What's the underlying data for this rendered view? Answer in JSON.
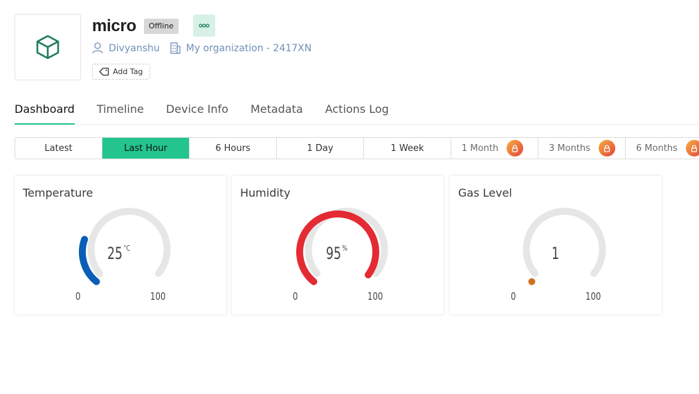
{
  "header": {
    "device_name": "micro",
    "status": "Offline",
    "owner": "Divyanshu",
    "organization": "My organization - 2417XN",
    "add_tag_label": "Add Tag"
  },
  "tabs": [
    {
      "label": "Dashboard",
      "active": true
    },
    {
      "label": "Timeline"
    },
    {
      "label": "Device Info"
    },
    {
      "label": "Metadata"
    },
    {
      "label": "Actions Log"
    }
  ],
  "time_ranges": [
    {
      "label": "Latest"
    },
    {
      "label": "Last Hour",
      "active": true
    },
    {
      "label": "6 Hours"
    },
    {
      "label": "1 Day"
    },
    {
      "label": "1 Week"
    },
    {
      "label": "1 Month",
      "locked": true
    },
    {
      "label": "3 Months",
      "locked": true
    },
    {
      "label": "6 Months",
      "locked": true
    }
  ],
  "widgets": [
    {
      "title": "Temperature",
      "value": "25",
      "unit": "°C",
      "min": "0",
      "max": "100",
      "fraction": 0.25,
      "color": "#0a5eb8"
    },
    {
      "title": "Humidity",
      "value": "95",
      "unit": "%",
      "min": "0",
      "max": "100",
      "fraction": 0.95,
      "color": "#e42a33"
    },
    {
      "title": "Gas Level",
      "value": "1",
      "unit": "",
      "min": "0",
      "max": "100",
      "fraction": 0.01,
      "color": "#d1701c"
    }
  ],
  "colors": {
    "accent": "#23c48e",
    "track": "#e6e6e6",
    "link": "#6f8fb9",
    "icon": "#1e7d5c"
  },
  "icons": {
    "device": "cube-icon",
    "owner": "user-icon",
    "organization": "building-icon",
    "tag": "tag-icon",
    "more": "more-dots-icon",
    "lock": "lock-icon"
  }
}
